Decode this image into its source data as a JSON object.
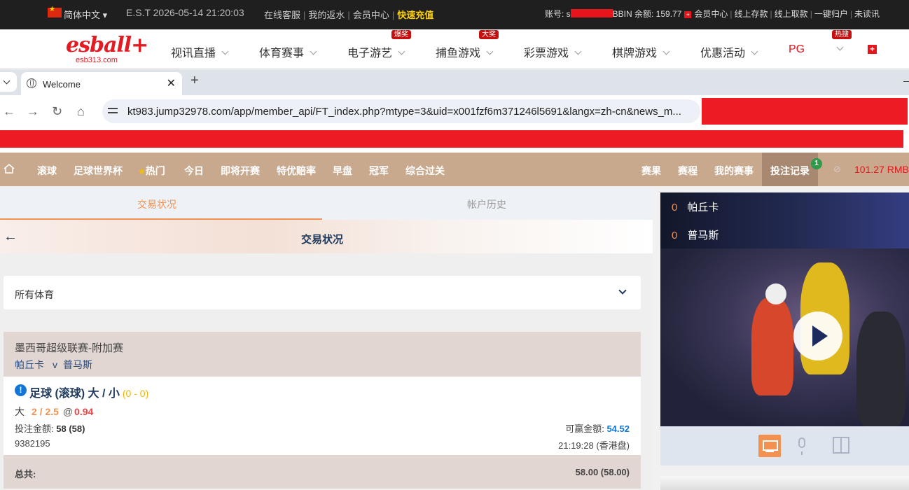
{
  "topbar": {
    "language": "简体中文 ▾",
    "est_time": "E.S.T 2026-05-14 21:20:03",
    "links": [
      "在线客服",
      "我的返水",
      "会员中心"
    ],
    "fast_deposit": "快速充值",
    "account_label": "账号: s",
    "bbin_balance": "BBIN 余额: 159.77",
    "account_links": [
      "会员中心",
      "线上存款",
      "线上取款",
      "一键归户",
      "未读讯"
    ]
  },
  "nav": {
    "logo_main": "esball+",
    "logo_sub": "esb313.com",
    "items": [
      {
        "label": "视讯直播"
      },
      {
        "label": "体育赛事"
      },
      {
        "label": "电子游艺",
        "badge": "爆奖"
      },
      {
        "label": "捕鱼游戏",
        "badge": "大奖"
      },
      {
        "label": "彩票游戏"
      },
      {
        "label": "棋牌游戏"
      },
      {
        "label": "优惠活动"
      },
      {
        "label": "PG"
      },
      {
        "label": "",
        "badge": "热搜"
      }
    ]
  },
  "browser": {
    "tab_title": "Welcome",
    "url": "kt983.jump32978.com/app/member_api/FT_index.php?mtype=3&uid=x001fzf6m371246l5691&langx=zh-cn&news_m..."
  },
  "sitemenu": {
    "left": [
      "滚球",
      "足球世界杯",
      "热门",
      "今日",
      "即将开赛",
      "特优赔率",
      "早盘",
      "冠军",
      "综合过关"
    ],
    "right": [
      "赛果",
      "赛程",
      "我的赛事",
      "投注记录"
    ],
    "bet_record_badge": "1",
    "balance": "101.27",
    "currency": "RMB"
  },
  "panel": {
    "tabs": [
      "交易状况",
      "帐户历史"
    ],
    "header_title": "交易状况",
    "sport_filter": "所有体育"
  },
  "bet": {
    "league": "墨西哥超级联赛-附加赛",
    "home": "帕丘卡",
    "vs": "v",
    "away": "普马斯",
    "type": "足球 (滚球) 大 / 小",
    "score": "(0 - 0)",
    "selection": "大",
    "handicap": "2 / 2.5",
    "at": "@",
    "odds": "0.94",
    "stake_label": "投注金额:",
    "stake": "58 (58)",
    "win_label": "可赢金额:",
    "win": "54.52",
    "ticket_id": "9382195",
    "time": "21:19:28 (香港盘)",
    "total_label": "总共:",
    "total": "58.00 (58.00)"
  },
  "live": {
    "home_score": "0",
    "home": "帕丘卡",
    "away_score": "0",
    "away": "普马斯"
  },
  "colors": {
    "accent_orange": "#f29150",
    "menu_brown": "#c9a98e",
    "redaction": "#ec1b24",
    "navy": "#203a5c"
  }
}
